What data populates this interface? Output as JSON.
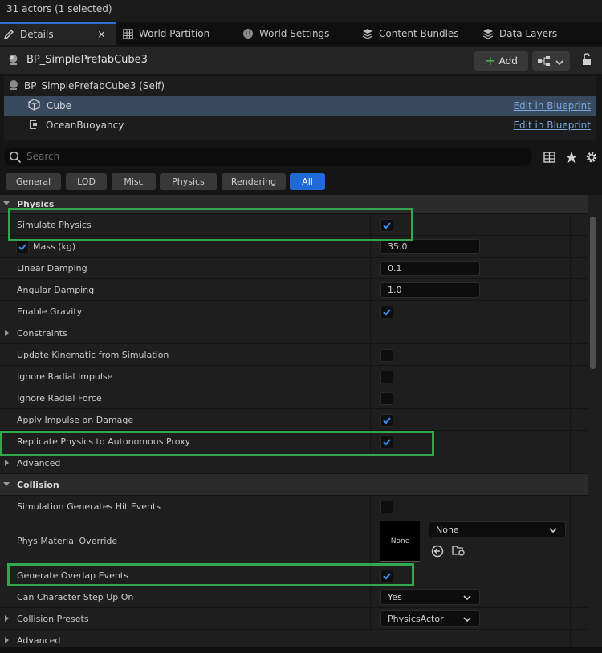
{
  "status": "31 actors (1 selected)",
  "tabs": [
    {
      "label": "Details",
      "icon": "pencil-icon"
    },
    {
      "label": "World Partition",
      "icon": "grid-icon"
    },
    {
      "label": "World Settings",
      "icon": "globe-icon"
    },
    {
      "label": "Content Bundles",
      "icon": "stack-icon"
    },
    {
      "label": "Data Layers",
      "icon": "layers-icon"
    }
  ],
  "actor": {
    "name": "BP_SimplePrefabCube3",
    "add_label": "Add"
  },
  "components": [
    {
      "label": "BP_SimplePrefabCube3 (Self)"
    },
    {
      "label": "Cube",
      "link": "Edit in Blueprint"
    },
    {
      "label": "OceanBuoyancy",
      "link": "Edit in Blueprint"
    }
  ],
  "search": {
    "placeholder": "Search"
  },
  "filters": [
    "General",
    "LOD",
    "Misc",
    "Physics",
    "Rendering",
    "All"
  ],
  "properties": {
    "physics_header": "Physics",
    "simulate_physics": "Simulate Physics",
    "mass": "Mass (kg)",
    "mass_value": "35.0",
    "linear_damping": "Linear Damping",
    "linear_damping_value": "0.1",
    "angular_damping": "Angular Damping",
    "angular_damping_value": "1.0",
    "enable_gravity": "Enable Gravity",
    "constraints": "Constraints",
    "update_kinematic": "Update Kinematic from Simulation",
    "ignore_radial_impulse": "Ignore Radial Impulse",
    "ignore_radial_force": "Ignore Radial Force",
    "apply_impulse": "Apply Impulse on Damage",
    "replicate_physics": "Replicate Physics to Autonomous Proxy",
    "advanced": "Advanced",
    "collision_header": "Collision",
    "sim_hit_events": "Simulation Generates Hit Events",
    "phys_material": "Phys Material Override",
    "phys_material_thumb": "None",
    "phys_material_value": "None",
    "overlap_events": "Generate Overlap Events",
    "step_up": "Can Character Step Up On",
    "step_up_value": "Yes",
    "collision_presets": "Collision Presets",
    "collision_presets_value": "PhysicsActor",
    "advanced2": "Advanced"
  },
  "colors": {
    "accent": "#1f6ad6",
    "highlight": "#2fa84f",
    "link": "#7aa7e0"
  }
}
